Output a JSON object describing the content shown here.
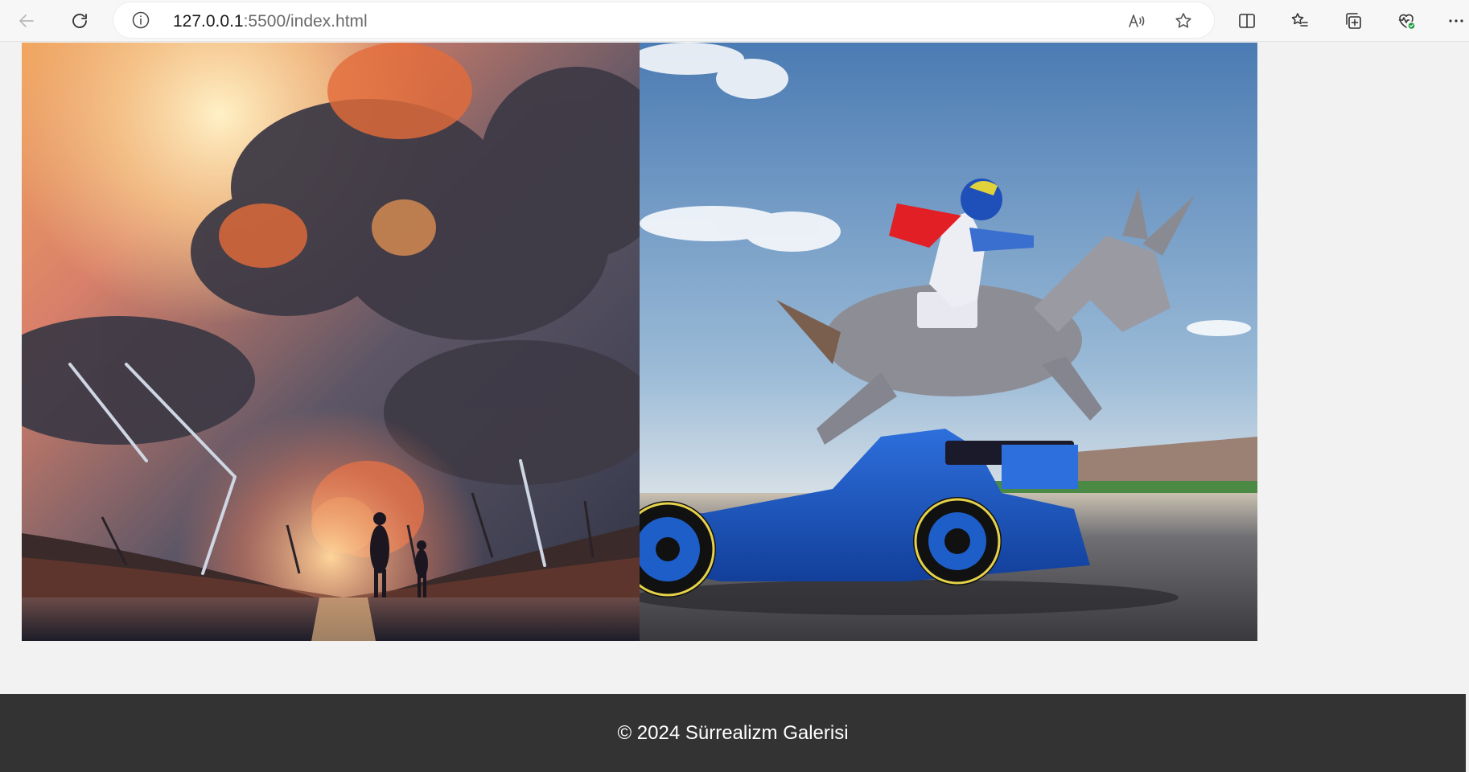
{
  "browser": {
    "url_host": "127.0.0.1",
    "url_rest": ":5500/index.html",
    "icons": {
      "back": "arrow-left-icon",
      "reload": "reload-icon",
      "site_info": "info-icon",
      "read_aloud": "read-aloud-icon",
      "favorite": "star-icon",
      "split_screen": "split-screen-icon",
      "favorites": "favorites-list-icon",
      "collections": "collections-icon",
      "browser_essentials": "heart-pulse-icon",
      "more": "more-icon"
    }
  },
  "gallery": {
    "images": [
      {
        "subject": "anime sunset sky with storm clouds, broken wind turbines and two figures walking on a wet road"
      },
      {
        "subject": "jockey with red cape riding a jumping donkey over a blue formula one race car"
      }
    ]
  },
  "footer": {
    "copyright": "© 2024 Sürrealizm Galerisi"
  },
  "colors": {
    "footer_bg": "#333333",
    "page_bg": "#f2f2f2",
    "toolbar_bg": "#f7f7f7"
  }
}
